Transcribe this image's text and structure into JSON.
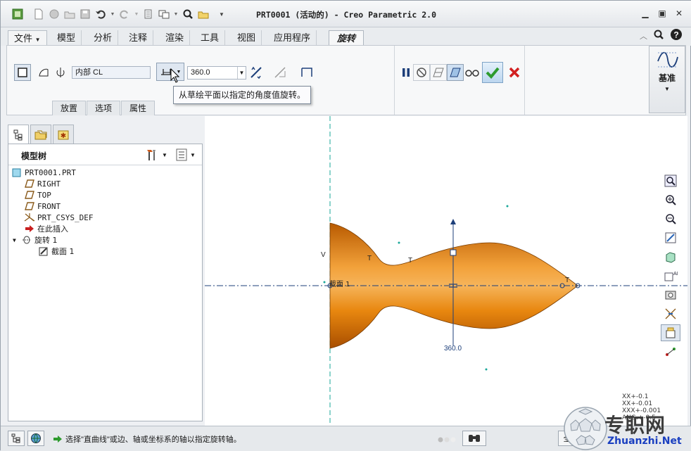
{
  "window": {
    "title": "PRT0001 (活动的) - Creo Parametric 2.0"
  },
  "ribbon_tabs": [
    {
      "label": "文件"
    },
    {
      "label": "模型"
    },
    {
      "label": "分析"
    },
    {
      "label": "注释"
    },
    {
      "label": "渲染"
    },
    {
      "label": "工具"
    },
    {
      "label": "视图"
    },
    {
      "label": "应用程序"
    },
    {
      "label": "旋转"
    }
  ],
  "revolve_dashboard": {
    "axis_value": "内部 CL",
    "angle_value": "360.0",
    "subtabs": [
      "放置",
      "选项",
      "属性"
    ],
    "datum_label": "基准"
  },
  "tooltip": {
    "text": "从草绘平面以指定的角度值旋转。"
  },
  "model_tree": {
    "title": "模型树",
    "items": [
      {
        "label": "PRT0001.PRT",
        "icon": "part-icon"
      },
      {
        "label": "RIGHT",
        "icon": "datum-plane-icon"
      },
      {
        "label": "TOP",
        "icon": "datum-plane-icon"
      },
      {
        "label": "FRONT",
        "icon": "datum-plane-icon"
      },
      {
        "label": "PRT_CSYS_DEF",
        "icon": "csys-icon"
      },
      {
        "label": "在此插入",
        "icon": "insert-here-arrow-icon"
      },
      {
        "label": "旋转 1",
        "icon": "revolve-feature-icon"
      },
      {
        "label": "截面 1",
        "icon": "sketch-section-icon"
      }
    ]
  },
  "graphics": {
    "label_v": "V",
    "label_t1": "T",
    "label_t2": "T",
    "label_t3": "T",
    "section_label": "截面 1",
    "angle_dim": "360.0",
    "tolerance": [
      "XX+-0.1",
      "XX+-0.01",
      "XXX+-0.001",
      "ANG.+-0.5"
    ]
  },
  "statusbar": {
    "message": "选择\"直曲线\"或边、轴或坐标系的轴以指定旋转轴。",
    "filter_label": "全"
  },
  "watermark": {
    "cn": "专职网",
    "url": "Zhuanzhi.Net"
  },
  "colors": {
    "model_orange": "#e8870f",
    "axis_teal": "#1aa79a",
    "confirm_green": "#2e9b2e",
    "cancel_red": "#d22020"
  }
}
